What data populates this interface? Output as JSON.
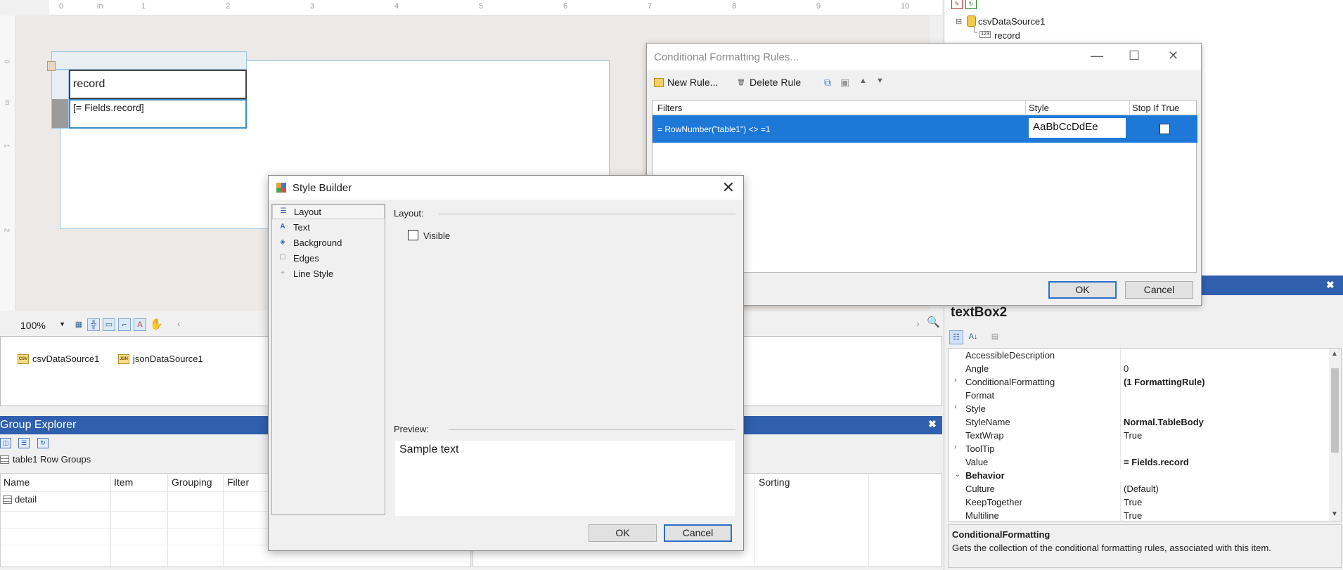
{
  "ruler": {
    "labels": [
      "0",
      "in",
      "1",
      "2",
      "3",
      "4",
      "5",
      "6",
      "7",
      "8",
      "9",
      "10"
    ],
    "vlabels": [
      "0",
      "in",
      "1",
      "2"
    ]
  },
  "report": {
    "header_cell": "record",
    "detail_cell": "[= Fields.record]"
  },
  "zoom": {
    "value": "100%"
  },
  "datasources": [
    "csvDataSource1",
    "jsonDataSource1"
  ],
  "group_explorer": {
    "title": "Group Explorer",
    "subtitle": "table1 Row Groups",
    "columns": [
      "Name",
      "Item",
      "Grouping",
      "Filter"
    ],
    "right_column": "Sorting",
    "rows": [
      "detail"
    ]
  },
  "tree": {
    "root": "csvDataSource1",
    "child": "record"
  },
  "properties": {
    "object_name": "textBox2",
    "rows": [
      {
        "name": "AccessibleDescription",
        "value": "",
        "exp": ""
      },
      {
        "name": "Angle",
        "value": "0",
        "exp": ""
      },
      {
        "name": "ConditionalFormatting",
        "value": "(1 FormattingRule)",
        "exp": ">",
        "bold": true
      },
      {
        "name": "Format",
        "value": "",
        "exp": ""
      },
      {
        "name": "Style",
        "value": "",
        "exp": ">"
      },
      {
        "name": "StyleName",
        "value": "Normal.TableBody",
        "exp": "",
        "bold": true
      },
      {
        "name": "TextWrap",
        "value": "True",
        "exp": ""
      },
      {
        "name": "ToolTip",
        "value": "",
        "exp": ">"
      },
      {
        "name": "Value",
        "value": "= Fields.record",
        "exp": "",
        "bold": true
      },
      {
        "name": "Behavior",
        "value": "",
        "exp": "v",
        "category": true
      },
      {
        "name": "Culture",
        "value": "(Default)",
        "exp": ""
      },
      {
        "name": "KeepTogether",
        "value": "True",
        "exp": ""
      },
      {
        "name": "Multiline",
        "value": "True",
        "exp": ""
      }
    ],
    "description_title": "ConditionalFormatting",
    "description_text": "Gets the collection of the conditional formatting rules, associated with this item."
  },
  "cf_dialog": {
    "title": "Conditional Formatting Rules...",
    "new_rule": "New Rule...",
    "delete_rule": "Delete Rule",
    "col_filters": "Filters",
    "col_style": "Style",
    "col_stop": "Stop If True",
    "rule_filter": "= RowNumber(\"table1\") <> =1",
    "rule_style_sample": "AaBbCcDdEe",
    "ok": "OK",
    "cancel": "Cancel"
  },
  "style_builder": {
    "title": "Style Builder",
    "nav": [
      "Layout",
      "Text",
      "Background",
      "Edges",
      "Line Style"
    ],
    "layout_heading": "Layout:",
    "visible_label": "Visible",
    "preview_heading": "Preview:",
    "preview_text": "Sample text",
    "ok": "OK",
    "cancel": "Cancel"
  },
  "colors": {
    "accent": "#2f5fad",
    "selection": "#1e78d7"
  }
}
